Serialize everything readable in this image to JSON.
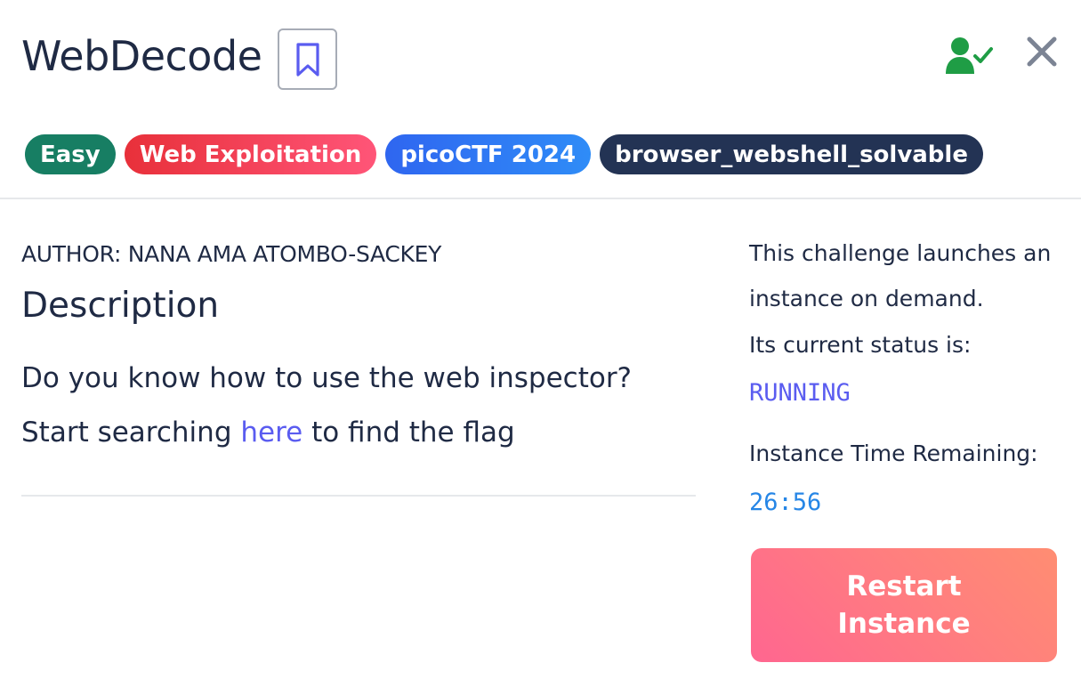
{
  "header": {
    "title": "WebDecode"
  },
  "icons": {
    "bookmark": "bookmark-icon",
    "user_check": "user-check-icon",
    "close": "close-icon"
  },
  "tags": [
    {
      "label": "Easy"
    },
    {
      "label": "Web Exploitation"
    },
    {
      "label": "picoCTF 2024"
    },
    {
      "label": "browser_webshell_solvable"
    }
  ],
  "colors": {
    "difficulty": "#177e63",
    "category": "#e8303a",
    "event": "#2f66f0",
    "misc_tag": "#233354",
    "link": "#5a5cf0",
    "status": "#5a5cf0",
    "timer": "#2686e6",
    "user_check": "#1f9d45",
    "restart_button": "#ff7f7e"
  },
  "main": {
    "author": "AUTHOR: NANA AMA ATOMBO-SACKEY",
    "description_heading": "Description",
    "description_line1": "Do you know how to use the web inspector?",
    "description_line2_before": "Start searching ",
    "description_link": "here",
    "description_line2_after": " to find the flag"
  },
  "instance": {
    "intro_line1": "This challenge launches an",
    "intro_line2": "instance on demand.",
    "status_label": "Its current status is:",
    "status_value": "RUNNING",
    "time_label": "Instance Time Remaining:",
    "time_value": "26:56",
    "restart_line1": "Restart",
    "restart_line2": "Instance"
  }
}
